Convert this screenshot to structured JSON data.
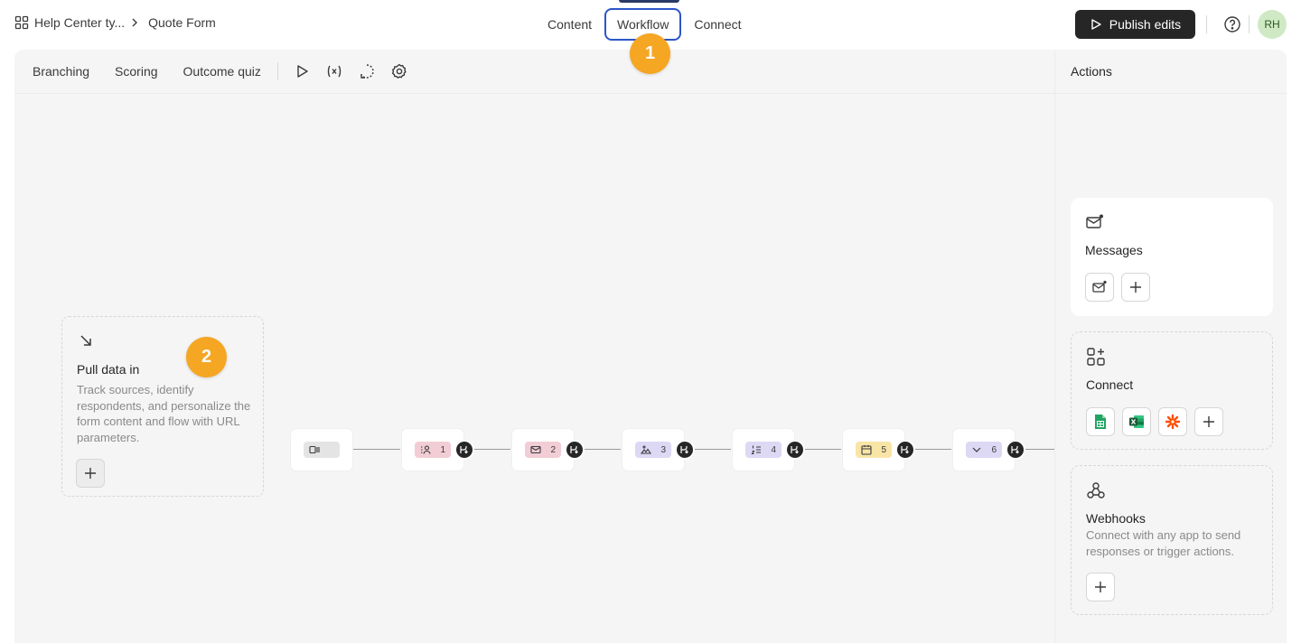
{
  "header": {
    "breadcrumb_parent": "Help Center ty...",
    "breadcrumb_current": "Quote Form",
    "tabs": [
      {
        "label": "Content",
        "active": false
      },
      {
        "label": "Workflow",
        "active": true
      },
      {
        "label": "Connect",
        "active": false
      }
    ],
    "publish_label": "Publish edits",
    "avatar_initials": "RH"
  },
  "toolbar": {
    "tools": [
      "Branching",
      "Scoring",
      "Outcome quiz"
    ],
    "icons": [
      "play-icon",
      "variable-icon",
      "logic-icon",
      "settings-icon"
    ]
  },
  "canvas": {
    "pull_data": {
      "title": "Pull data in",
      "description": "Track sources, identify respondents, and personalize the form content and flow with URL parameters."
    },
    "steps": [
      {
        "number": "",
        "icon": "welcome-icon",
        "color": "#e4e4e4"
      },
      {
        "number": "1",
        "icon": "contact-info-icon",
        "color": "#f2cdd6"
      },
      {
        "number": "2",
        "icon": "email-icon",
        "color": "#f2cdd6"
      },
      {
        "number": "3",
        "icon": "picture-choice-icon",
        "color": "#ddd8f4"
      },
      {
        "number": "4",
        "icon": "ranking-icon",
        "color": "#ddd8f4"
      },
      {
        "number": "5",
        "icon": "date-icon",
        "color": "#f8e5a6"
      },
      {
        "number": "6",
        "icon": "dropdown-icon",
        "color": "#ddd8f4"
      }
    ],
    "callouts": [
      "1",
      "2"
    ]
  },
  "actions": {
    "title": "Actions",
    "messages": {
      "title": "Messages"
    },
    "connect": {
      "title": "Connect",
      "apps": [
        "google-sheets-icon",
        "excel-icon",
        "zapier-icon"
      ]
    },
    "webhooks": {
      "title": "Webhooks",
      "description": "Connect with any app to send responses or trigger actions."
    }
  }
}
